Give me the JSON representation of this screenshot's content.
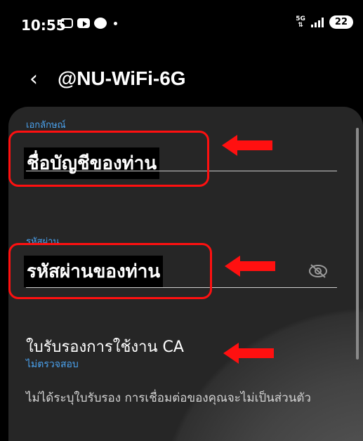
{
  "status_bar": {
    "time": "10:55",
    "network": "5G",
    "battery": "22",
    "icons": [
      "screen-record-icon",
      "youtube-icon",
      "line-icon"
    ]
  },
  "header": {
    "title": "@NU-WiFi-6G",
    "back_icon": "chevron-left-icon"
  },
  "identity": {
    "label": "เอกลักษณ์",
    "value": "ชื่อบัญชีของท่าน"
  },
  "password": {
    "label": "รหัสผ่าน",
    "value": "รหัสผ่านของท่าน",
    "toggle_icon": "eye-off-icon"
  },
  "ca_certificate": {
    "title": "ใบรับรองการใช้งาน CA",
    "value": "ไม่ตรวจสอบ"
  },
  "note": "ไม่ได้ระบุใบรับรอง การเชื่อมต่อของคุณจะไม่เป็นส่วนตัว",
  "colors": {
    "accent": "#4ba3f0",
    "highlight": "#ff1010",
    "card": "#262626"
  }
}
